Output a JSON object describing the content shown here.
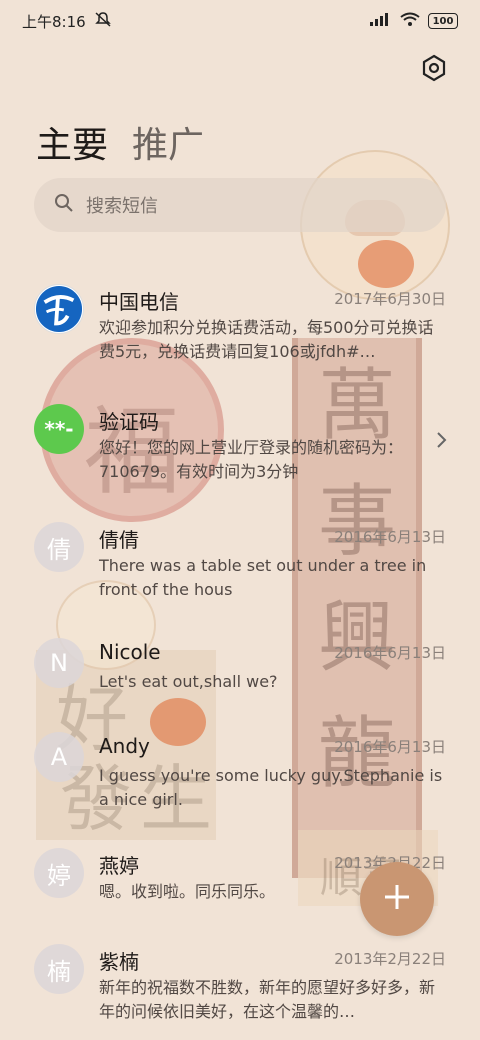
{
  "status_bar": {
    "time": "上午8:16",
    "battery": "100"
  },
  "tabs": {
    "primary": "主要",
    "secondary": "推广"
  },
  "search": {
    "placeholder": "搜索短信"
  },
  "background_text": {
    "fu": "福",
    "scroll": [
      "萬",
      "事",
      "興",
      "龍"
    ],
    "bottom_left": [
      "好",
      "發",
      "生"
    ],
    "sign": "順意"
  },
  "conversations": [
    {
      "name": "中国电信",
      "date": "2017年6月30日",
      "preview": "欢迎参加积分兑换话费活动，每500分可兑换话费5元，兑换话费请回复106或jfdh#…",
      "avatar": "telecom-logo"
    },
    {
      "name": "验证码",
      "date": "",
      "preview": "您好！您的网上营业厅登录的随机密码为：710679。有效时间为3分钟",
      "avatar": "**-"
    },
    {
      "name": "倩倩",
      "date": "2016年6月13日",
      "preview": "There was a table set out under a tree in front of the hous",
      "avatar": "倩"
    },
    {
      "name": "Nicole",
      "date": "2016年6月13日",
      "preview": "Let's eat out,shall we?",
      "avatar": "N"
    },
    {
      "name": "Andy",
      "date": "2016年6月13日",
      "preview": "I guess you're some lucky guy.Stephanie is a nice girl.",
      "avatar": "A"
    },
    {
      "name": "燕婷",
      "date": "2013年2月22日",
      "preview": "嗯。收到啦。同乐同乐。",
      "avatar": "婷"
    },
    {
      "name": "紫楠",
      "date": "2013年2月22日",
      "preview": "新年的祝福数不胜数，新年的愿望好多好多，新年的问候依旧美好，在这个温馨的…",
      "avatar": "楠"
    }
  ],
  "colors": {
    "background": "#f1e3d6",
    "fab": "#c99672",
    "verification_avatar": "#5dc94d",
    "telecom_blue": "#1565c0"
  },
  "icons": {
    "settings": "gear-icon",
    "search": "search-icon",
    "fab": "plus-icon",
    "chevron": "chevron-right-icon"
  }
}
